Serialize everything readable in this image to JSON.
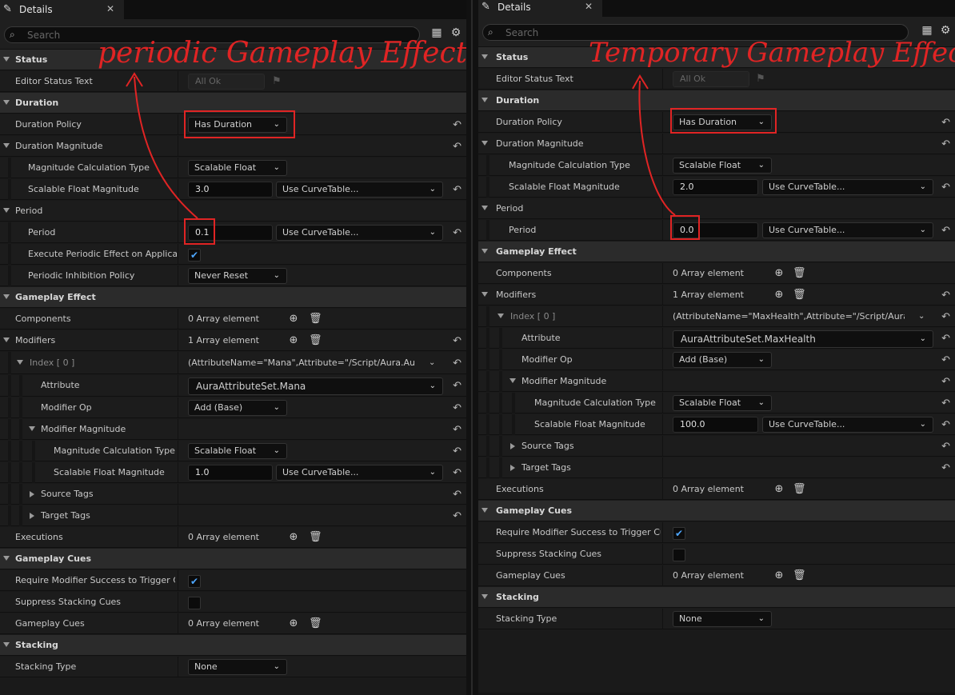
{
  "left": {
    "tab": {
      "label": "Details",
      "close": "✕",
      "icon": "pencil-icon"
    },
    "search": {
      "placeholder": "Search"
    },
    "annotation": "periodic Gameplay Effect",
    "rows": {
      "status": "Status",
      "editor_status_text": "Editor Status Text",
      "editor_status_value": "All Ok",
      "duration": "Duration",
      "duration_policy": "Duration Policy",
      "duration_policy_value": "Has Duration",
      "duration_magnitude": "Duration Magnitude",
      "mag_calc_type": "Magnitude Calculation Type",
      "mag_calc_type_value": "Scalable Float",
      "scalable_float_mag": "Scalable Float Magnitude",
      "scalable_float_mag_value": "3.0",
      "curve_table": "Use CurveTable...",
      "period_cat": "Period",
      "period": "Period",
      "period_value": "0.1",
      "exec_periodic": "Execute Periodic Effect on Applicati...",
      "periodic_inhibition": "Periodic Inhibition Policy",
      "periodic_inhibition_value": "Never Reset",
      "gameplay_effect": "Gameplay Effect",
      "components": "Components",
      "components_value": "0 Array element",
      "modifiers": "Modifiers",
      "modifiers_value": "1 Array element",
      "index0": "Index [ 0 ]",
      "index0_value": "(AttributeName=\"Mana\",Attribute=\"/Script/Aura.AuraAtt",
      "attribute": "Attribute",
      "attribute_value": "AuraAttributeSet.Mana",
      "modifier_op": "Modifier Op",
      "modifier_op_value": "Add (Base)",
      "modifier_magnitude": "Modifier Magnitude",
      "mm_calc_type": "Magnitude Calculation Type",
      "mm_calc_type_value": "Scalable Float",
      "mm_sfm": "Scalable Float Magnitude",
      "mm_sfm_value": "1.0",
      "source_tags": "Source Tags",
      "target_tags": "Target Tags",
      "executions": "Executions",
      "executions_value": "0 Array element",
      "gameplay_cues": "Gameplay Cues",
      "require_mod_success": "Require Modifier Success to Trigger C...",
      "suppress_stacking": "Suppress Stacking Cues",
      "gameplay_cues_arr": "Gameplay Cues",
      "gameplay_cues_arr_value": "0 Array element",
      "stacking": "Stacking",
      "stacking_type": "Stacking Type",
      "stacking_type_value": "None"
    }
  },
  "right": {
    "tab": {
      "label": "Details",
      "close": "✕",
      "icon": "pencil-icon"
    },
    "search": {
      "placeholder": "Search"
    },
    "annotation": "Temporary Gameplay Effect",
    "rows": {
      "status": "Status",
      "editor_status_text": "Editor Status Text",
      "editor_status_value": "All Ok",
      "duration": "Duration",
      "duration_policy": "Duration Policy",
      "duration_policy_value": "Has Duration",
      "duration_magnitude": "Duration Magnitude",
      "mag_calc_type": "Magnitude Calculation Type",
      "mag_calc_type_value": "Scalable Float",
      "scalable_float_mag": "Scalable Float Magnitude",
      "scalable_float_mag_value": "2.0",
      "curve_table": "Use CurveTable...",
      "period_cat": "Period",
      "period": "Period",
      "period_value": "0.0",
      "gameplay_effect": "Gameplay Effect",
      "components": "Components",
      "components_value": "0 Array element",
      "modifiers": "Modifiers",
      "modifiers_value": "1 Array element",
      "index0": "Index [ 0 ]",
      "index0_value": "(AttributeName=\"MaxHealth\",Attribute=\"/Script/Aura.Aura",
      "attribute": "Attribute",
      "attribute_value": "AuraAttributeSet.MaxHealth",
      "modifier_op": "Modifier Op",
      "modifier_op_value": "Add (Base)",
      "modifier_magnitude": "Modifier Magnitude",
      "mm_calc_type": "Magnitude Calculation Type",
      "mm_calc_type_value": "Scalable Float",
      "mm_sfm": "Scalable Float Magnitude",
      "mm_sfm_value": "100.0",
      "source_tags": "Source Tags",
      "target_tags": "Target Tags",
      "executions": "Executions",
      "executions_value": "0 Array element",
      "gameplay_cues": "Gameplay Cues",
      "require_mod_success": "Require Modifier Success to Trigger Cu...",
      "suppress_stacking": "Suppress Stacking Cues",
      "gameplay_cues_arr": "Gameplay Cues",
      "gameplay_cues_arr_value": "0 Array element",
      "stacking": "Stacking",
      "stacking_type": "Stacking Type",
      "stacking_type_value": "None"
    }
  },
  "colors": {
    "annotation_red": "#e02424",
    "checkbox_blue": "#4da6ff"
  }
}
